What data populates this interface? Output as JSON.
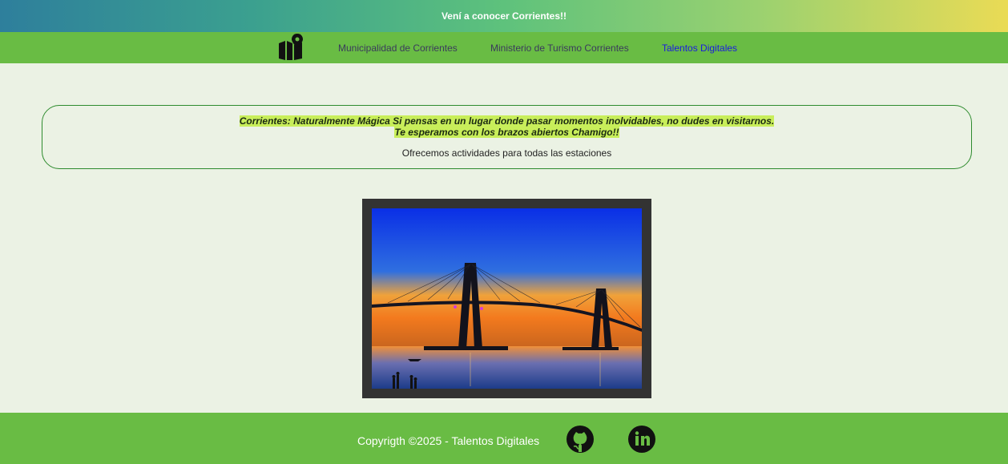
{
  "banner": {
    "text": "Vení a conocer Corrientes!!"
  },
  "nav": {
    "logo_icon": "map-marker-icon",
    "links": [
      "Municipalidad de Corrientes",
      "Ministerio de Turismo Corrientes",
      "Talentos Digitales"
    ]
  },
  "intro": {
    "highlight_line1": "Corrientes: Naturalmente Mágica Si pensas en un lugar donde pasar momentos inolvidables, no dudes en visitarnos.",
    "highlight_line2": "Te esperamos con los brazos abiertos Chamigo!!",
    "subtitle": "Ofrecemos actividades para todas las estaciones"
  },
  "photo": {
    "subject": "cable-stayed bridge at sunset"
  },
  "footer": {
    "copyright": "Copyrigth ©2025 - Talentos Digitales",
    "icons": [
      "github-icon",
      "linkedin-icon"
    ]
  },
  "colors": {
    "nav_bg": "#69bc44",
    "highlight": "#c8ee5a",
    "box_border": "#2e8b2e",
    "page_bg": "#ebf2e4",
    "active_link": "#1a1ae0"
  }
}
